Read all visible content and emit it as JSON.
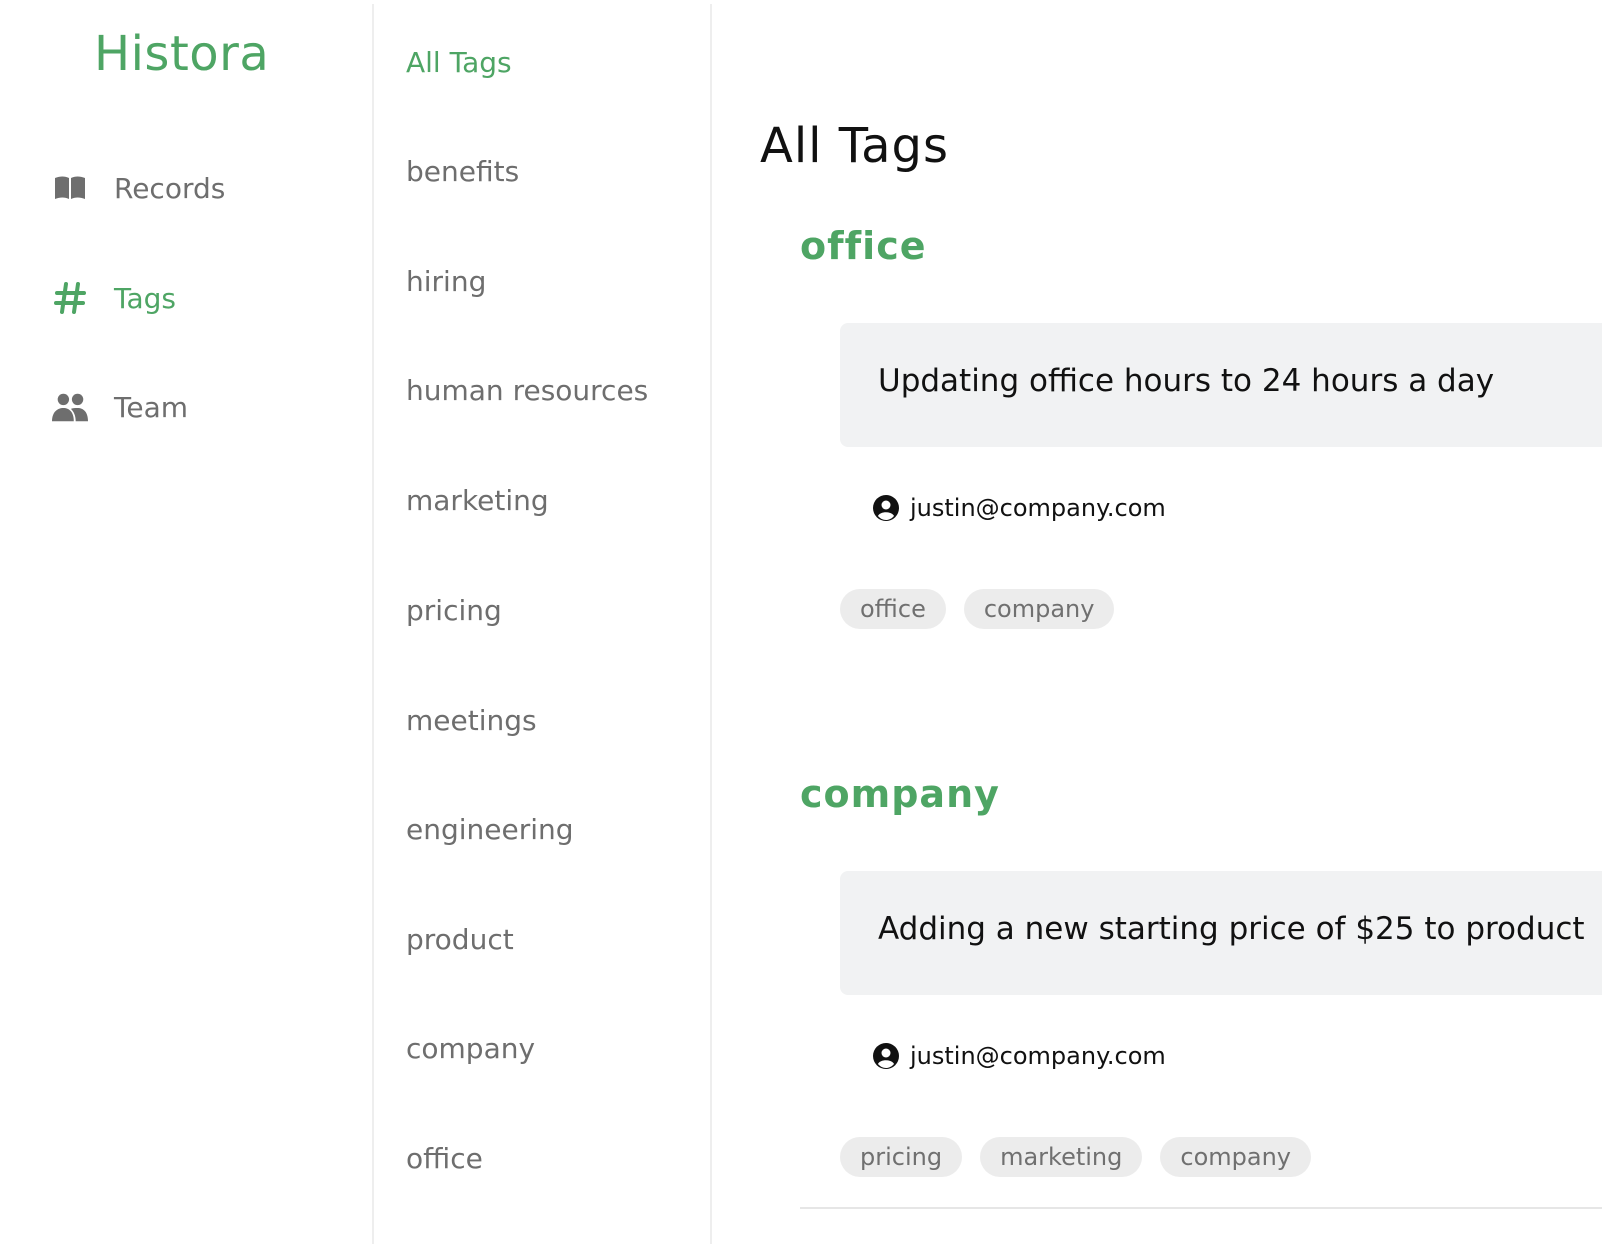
{
  "brand": {
    "name": "Histora",
    "color": "#4ea564"
  },
  "nav": {
    "items": [
      {
        "label": "Records",
        "icon": "book-icon",
        "active": false
      },
      {
        "label": "Tags",
        "icon": "hash-icon",
        "active": true
      },
      {
        "label": "Team",
        "icon": "people-icon",
        "active": false
      }
    ]
  },
  "tags": {
    "items": [
      "All Tags",
      "benefits",
      "hiring",
      "human resources",
      "marketing",
      "pricing",
      "meetings",
      "engineering",
      "product",
      "company",
      "office"
    ],
    "active_index": 0
  },
  "main": {
    "title": "All Tags",
    "sections": [
      {
        "tag": "office",
        "record": {
          "title": "Updating office hours to 24 hours a day",
          "author": "justin@company.com",
          "tags": [
            "office",
            "company"
          ]
        }
      },
      {
        "tag": "company",
        "record": {
          "title": "Adding a new starting price of $25 to product",
          "author": "justin@company.com",
          "tags": [
            "pricing",
            "marketing",
            "company"
          ]
        }
      }
    ]
  }
}
